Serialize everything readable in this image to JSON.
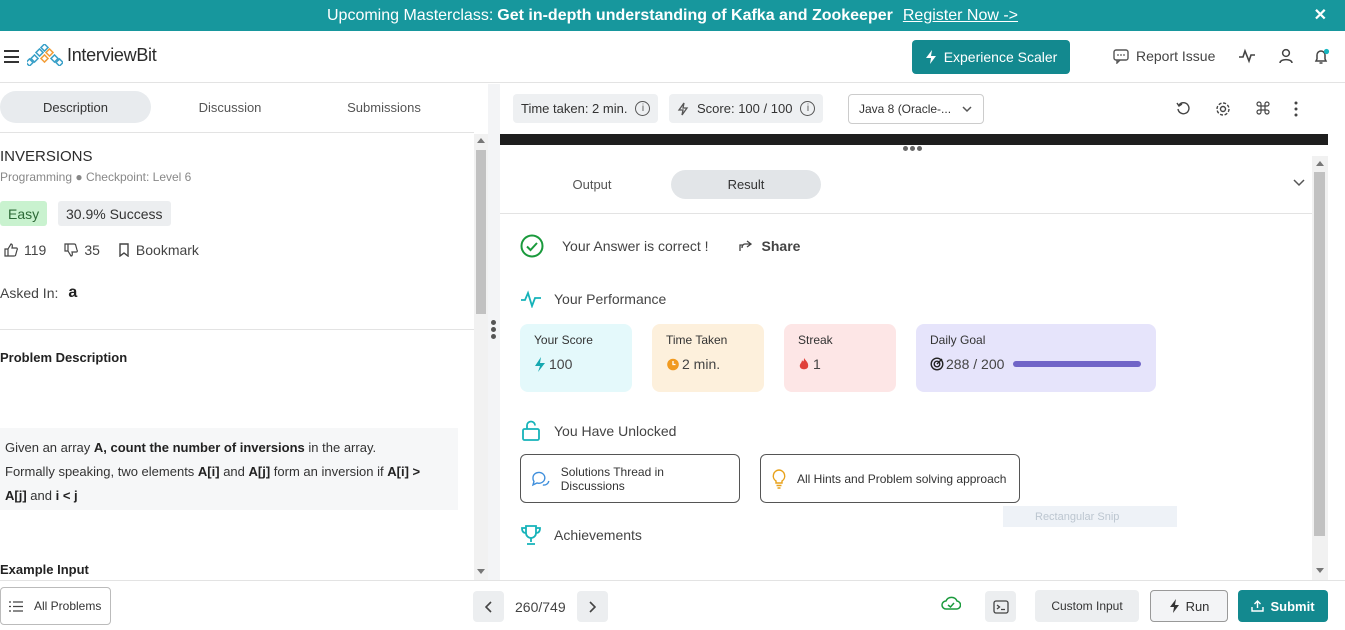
{
  "banner": {
    "prefix": "Upcoming Masterclass:",
    "headline": "Get in-depth understanding of Kafka and Zookeeper",
    "register": "Register Now ->",
    "close": "✕"
  },
  "nav": {
    "logo_text": "InterviewBit",
    "experience_button": "Experience Scaler",
    "report_issue": "Report Issue"
  },
  "tabs": [
    "Description",
    "Discussion",
    "Submissions"
  ],
  "problem": {
    "title": "INVERSIONS",
    "subtitle": "Programming ● Checkpoint: Level 6",
    "difficulty": "Easy",
    "success": "30.9% Success",
    "likes": "119",
    "dislikes": "35",
    "bookmark": "Bookmark",
    "asked_in": "Asked In:",
    "company_logo": "a",
    "description_heading": "Problem Description",
    "desc_l1_a": "Given an array ",
    "desc_l1_b": "A, count the number of inversions",
    "desc_l1_c": " in the array.",
    "desc_l2_a": "Formally speaking, two elements ",
    "desc_l2_b": "A[i]",
    "desc_l2_c": " and ",
    "desc_l2_d": "A[j]",
    "desc_l2_e": " form an inversion if ",
    "desc_l2_f": "A[i] >",
    "desc_l3_a": "A[j]",
    "desc_l3_b": " and ",
    "desc_l3_c": "i < j",
    "example_heading": "Example Input"
  },
  "toolbar": {
    "time_taken": "Time taken: 2 min.",
    "score_label": "Score:",
    "score_value": "100",
    "score_sep": "/",
    "score_total": "100",
    "language": "Java 8 (Oracle-..."
  },
  "result": {
    "tabs": [
      "Output",
      "Result"
    ],
    "correct_text": "Your Answer is correct !",
    "share": "Share",
    "performance_heading": "Your Performance",
    "cards": {
      "score": {
        "label": "Your Score",
        "value": "100",
        "icon": "bolt-icon",
        "bg": "#e4f9fb"
      },
      "time": {
        "label": "Time Taken",
        "value": "2 min.",
        "icon": "clock-icon",
        "bg": "#fdf0dc"
      },
      "streak": {
        "label": "Streak",
        "value": "1",
        "icon": "flame-icon",
        "bg": "#fde6e6"
      },
      "goal": {
        "label": "Daily Goal",
        "value": "288 / 200",
        "icon": "target-icon",
        "bg": "#e6e4fb",
        "progress": 1.0
      }
    },
    "unlocked_heading": "You Have Unlocked",
    "unlocked": [
      "Solutions Thread in Discussions",
      "All Hints and Problem solving approach"
    ],
    "achievements_heading": "Achievements",
    "ghost_overlay": "Rectangular Snip"
  },
  "bottom": {
    "all_problems": "All Problems",
    "page_counter": "260/749",
    "custom_input": "Custom Input",
    "run": "Run",
    "submit": "Submit"
  },
  "colors": {
    "brand": "#17979d",
    "accent": "#13898f",
    "success": "#1a9a3c"
  }
}
